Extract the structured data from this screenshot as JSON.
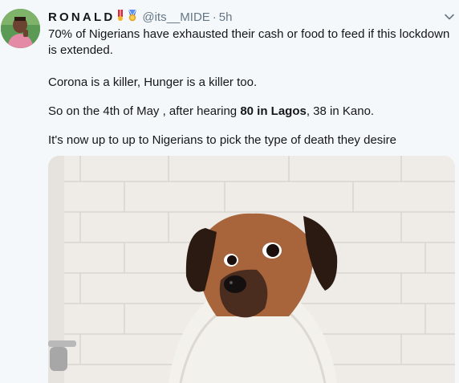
{
  "tweet": {
    "display_name": "RONALD",
    "badges": [
      "flag-badge-icon",
      "medal-badge-icon"
    ],
    "handle": "@its__MIDE",
    "separator": "·",
    "time": "5h",
    "menu_icon": "chevron-down-icon",
    "text": {
      "p1": "70% of Nigerians have exhausted their cash or food to feed if this lockdown is extended.",
      "p2": "Corona is a killer, Hunger is a killer too.",
      "p3_before": "So on the 4th of May , after hearing ",
      "p3_bold": "80 in Lagos",
      "p3_after": ", 38 in Kano.",
      "p4": "It's now up to up to Nigerians to pick the type of death they desire"
    },
    "media_icon": "dog-in-towel-photo"
  },
  "colors": {
    "background": "#f5f8fa",
    "text": "#14171a",
    "secondary": "#657786"
  }
}
